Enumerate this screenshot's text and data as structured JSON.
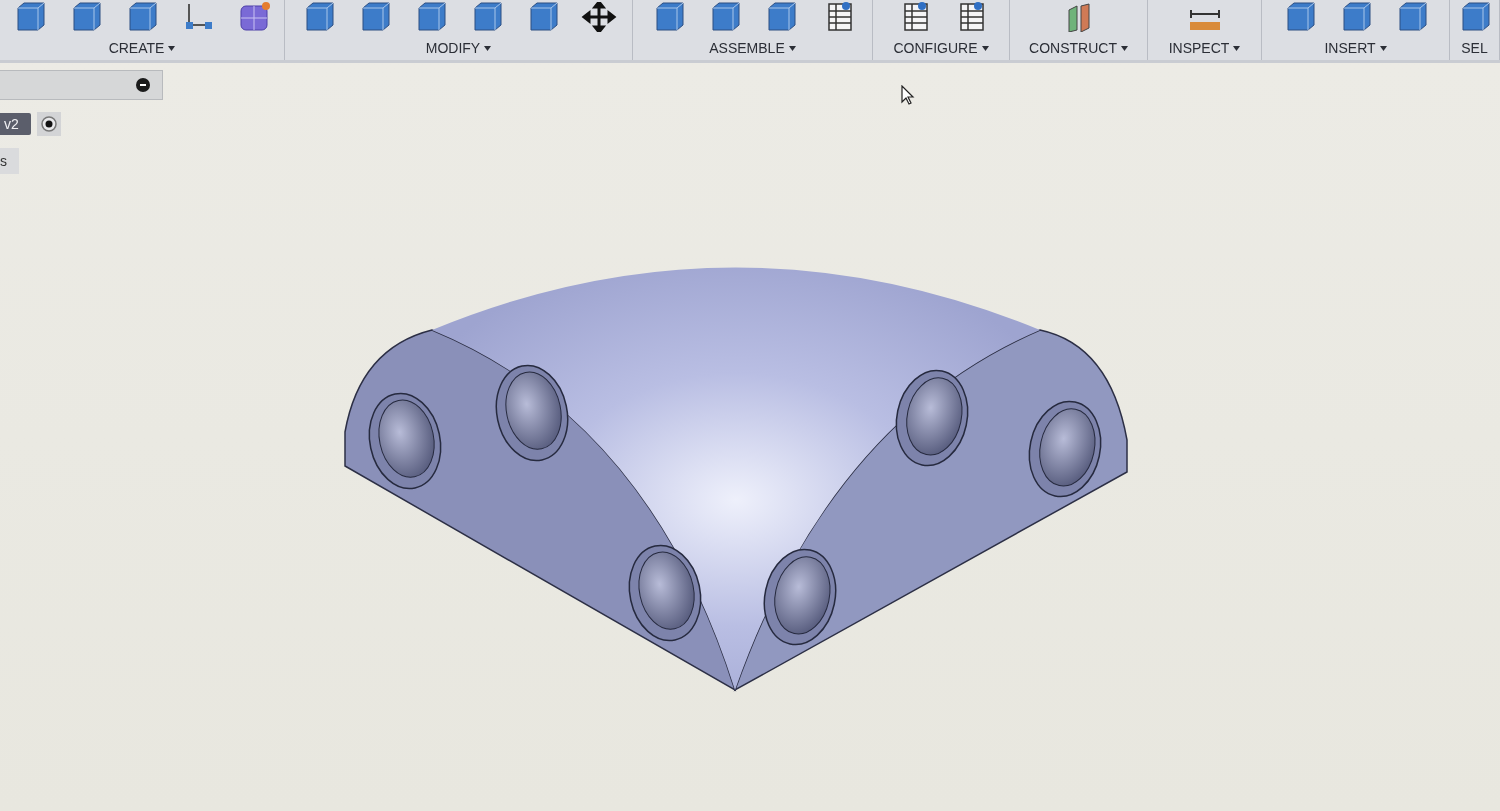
{
  "toolbar": {
    "groups": [
      {
        "label": "CREATE"
      },
      {
        "label": "MODIFY"
      },
      {
        "label": "ASSEMBLE"
      },
      {
        "label": "CONFIGURE"
      },
      {
        "label": "CONSTRUCT"
      },
      {
        "label": "INSPECT"
      },
      {
        "label": "INSERT"
      },
      {
        "label": "SEL"
      }
    ]
  },
  "browser": {
    "version_tag": "v2",
    "row_text": "s"
  }
}
